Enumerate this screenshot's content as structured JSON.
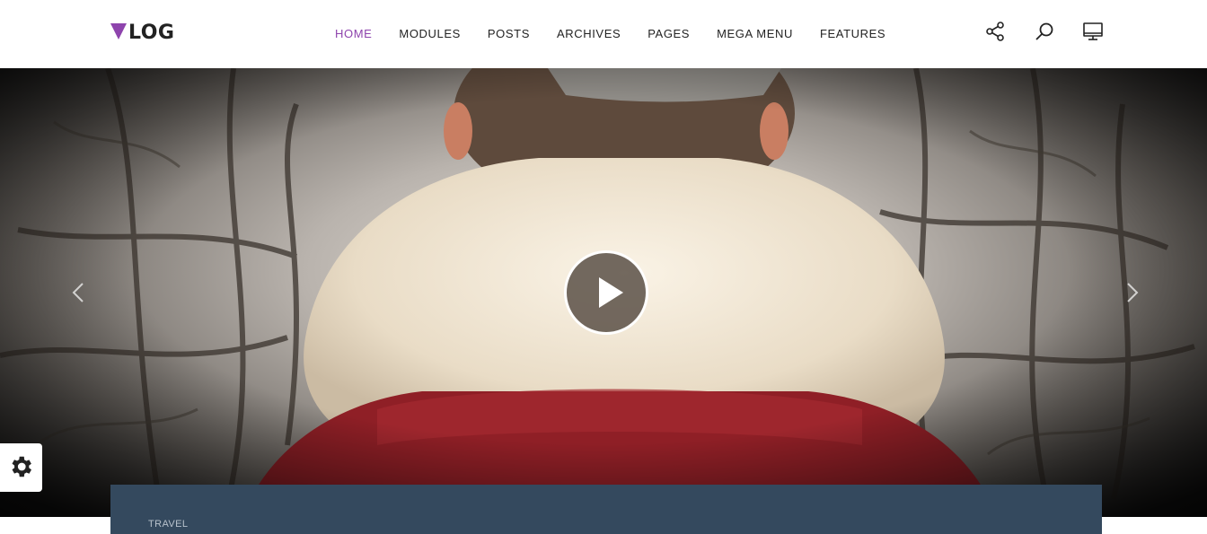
{
  "brand": {
    "logo_text": "LOG",
    "accent_color": "#8e44ad"
  },
  "nav": {
    "items": [
      {
        "label": "HOME",
        "active": true
      },
      {
        "label": "MODULES",
        "active": false
      },
      {
        "label": "POSTS",
        "active": false
      },
      {
        "label": "ARCHIVES",
        "active": false
      },
      {
        "label": "PAGES",
        "active": false
      },
      {
        "label": "MEGA MENU",
        "active": false
      },
      {
        "label": "FEATURES",
        "active": false
      }
    ]
  },
  "header_icons": [
    "share-icon",
    "search-icon",
    "monitor-icon"
  ],
  "hero": {
    "controls": [
      "prev-arrow-icon",
      "play-icon",
      "next-arrow-icon"
    ]
  },
  "post": {
    "category": "TRAVEL",
    "card_color": "#34495e"
  }
}
